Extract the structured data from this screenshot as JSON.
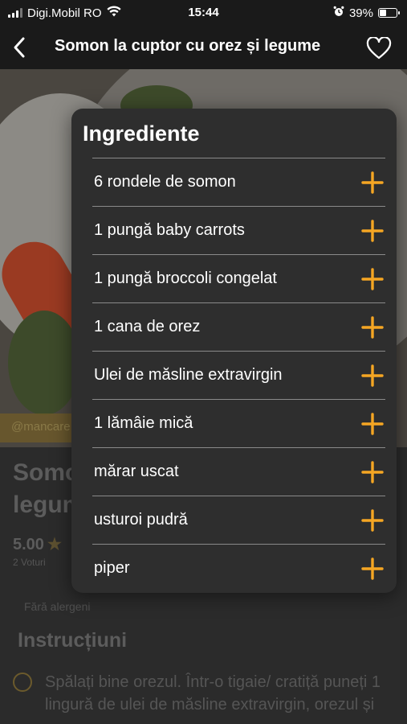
{
  "status_bar": {
    "carrier": "Digi.Mobil RO",
    "time": "15:44",
    "battery_percent": "39%",
    "battery_level": 0.39
  },
  "nav": {
    "title": "Somon la cuptor cu orez și legume",
    "back_icon": "chevron-left-icon",
    "favorite_icon": "heart-outline-icon"
  },
  "background": {
    "credit": "@mancare",
    "title": "Somon la cuptor cu orez și legume",
    "rating": "5.00",
    "votes": "2 Voturi",
    "allergen": "Fără alergeni",
    "section_title": "Instrucțiuni",
    "step_1": "Spălați bine orezul. Într-o tigaie/ cratiță puneți 1 lingură de ulei de măsline extravirgin, orezul și"
  },
  "ingredients_popover": {
    "title": "Ingrediente",
    "add_icon": "plus-icon",
    "accent_color": "#f5a623",
    "items": [
      {
        "label": "6 rondele de somon"
      },
      {
        "label": "1 pungă baby carrots"
      },
      {
        "label": "1 pungă broccoli congelat"
      },
      {
        "label": "1 cana de orez"
      },
      {
        "label": "Ulei de măsline extravirgin"
      },
      {
        "label": "1 lămâie mică"
      },
      {
        "label": "mărar uscat"
      },
      {
        "label": "usturoi pudră"
      },
      {
        "label": "piper"
      }
    ]
  }
}
